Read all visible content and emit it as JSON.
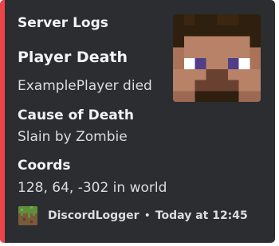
{
  "embed": {
    "accent_color": "#ee4449",
    "background_color": "#2b2d31",
    "author": "Server Logs",
    "title": "Player Death",
    "description": "ExamplePlayer died",
    "thumbnail_icon": "minecraft-steve-head-icon",
    "fields": [
      {
        "name": "Cause of Death",
        "value": "Slain by Zombie"
      },
      {
        "name": "Coords",
        "value": "128, 64, -302 in world"
      }
    ],
    "footer": {
      "icon": "grass-block-icon",
      "text": "DiscordLogger",
      "separator": "•",
      "timestamp": "Today at 12:45"
    }
  }
}
